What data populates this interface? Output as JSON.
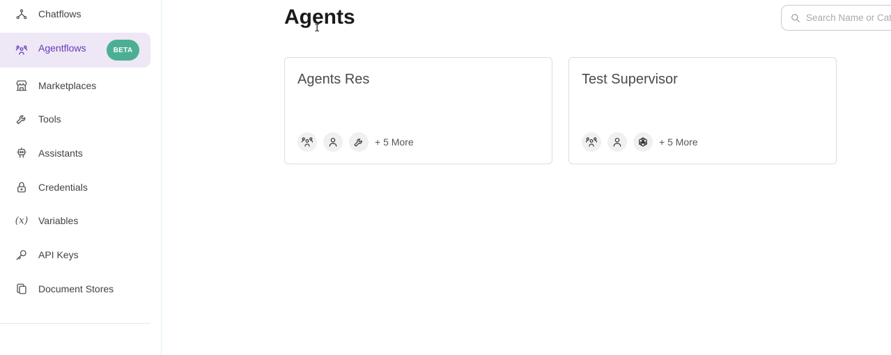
{
  "sidebar": {
    "items": [
      {
        "label": "Chatflows",
        "icon": "chatflows-icon"
      },
      {
        "label": "Agentflows",
        "icon": "agentflows-icon",
        "badge": "BETA",
        "active": true
      },
      {
        "label": "Marketplaces",
        "icon": "marketplace-icon"
      },
      {
        "label": "Tools",
        "icon": "tool-icon"
      },
      {
        "label": "Assistants",
        "icon": "robot-icon"
      },
      {
        "label": "Credentials",
        "icon": "lock-icon"
      },
      {
        "label": "Variables",
        "icon": "variable-icon",
        "glyph": "(x)"
      },
      {
        "label": "API Keys",
        "icon": "key-icon"
      },
      {
        "label": "Document Stores",
        "icon": "files-icon"
      }
    ]
  },
  "header": {
    "title": "Agents",
    "search_placeholder": "Search Name or Category"
  },
  "cards": [
    {
      "title": "Agents Res",
      "icons": [
        "users-icon",
        "user-icon",
        "tool-icon"
      ],
      "more": "+ 5 More"
    },
    {
      "title": "Test Supervisor",
      "icons": [
        "users-icon",
        "user-icon",
        "openai-icon"
      ],
      "more": "+ 5 More"
    }
  ],
  "colors": {
    "accent": "#673ab7",
    "active_bg": "#ede7f6",
    "badge": "#4caf93"
  }
}
